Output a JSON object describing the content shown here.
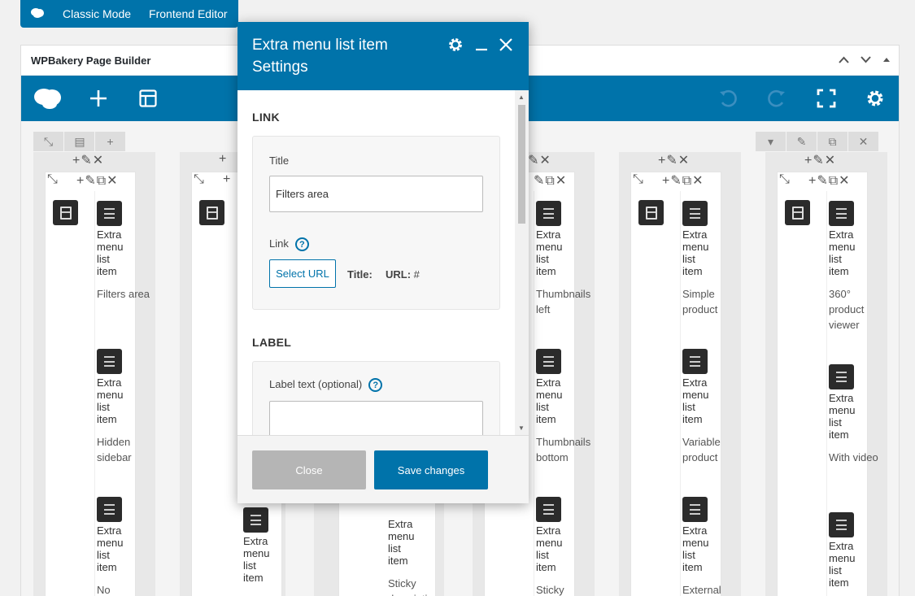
{
  "modes": {
    "classic": "Classic Mode",
    "frontend": "Frontend Editor"
  },
  "panel": {
    "title": "WPBakery Page Builder"
  },
  "modal": {
    "title": "Extra menu list item Settings",
    "link_section": "LINK",
    "title_label": "Title",
    "title_value": "Filters area",
    "link_label": "Link",
    "select_url": "Select URL",
    "title_meta": "Title:",
    "url_meta": "URL: #",
    "label_section": "LABEL",
    "label_text": "Label text (optional)",
    "label_value": "",
    "close": "Close",
    "save": "Save changes"
  },
  "columns": [
    {
      "blocks": [
        {
          "name": "Extra menu list item",
          "value": "Filters area"
        },
        {
          "name": "Extra menu list item",
          "value": "Hidden sidebar"
        },
        {
          "name": "Extra menu list item",
          "value": "No"
        }
      ]
    },
    {
      "blocks": [
        {
          "name": "Extra menu list item",
          "value": ""
        }
      ]
    },
    {
      "blocks": [
        {
          "name": "Extra menu list item",
          "value": "Sticky description"
        }
      ]
    },
    {
      "blocks": [
        {
          "name": "Extra menu list item",
          "value": "Thumbnails left"
        },
        {
          "name": "Extra menu list item",
          "value": "Thumbnails bottom"
        },
        {
          "name": "Extra menu list item",
          "value": "Sticky"
        }
      ]
    },
    {
      "blocks": [
        {
          "name": "Extra menu list item",
          "value": "Simple product"
        },
        {
          "name": "Extra menu list item",
          "value": "Variable product"
        },
        {
          "name": "Extra menu list item",
          "value": "External"
        }
      ]
    },
    {
      "blocks": [
        {
          "name": "Extra menu list item",
          "value": "360° product viewer"
        },
        {
          "name": "Extra menu list item",
          "value": "With video"
        },
        {
          "name": "Extra menu list item",
          "value": ""
        }
      ]
    }
  ],
  "icons": {
    "logo": "wpbakery-cloud-icon",
    "add": "plus-icon",
    "layout": "layout-template-icon",
    "undo": "undo-icon",
    "redo": "redo-icon",
    "fullscreen": "fullscreen-icon",
    "settings": "gear-icon"
  },
  "colors": {
    "brand": "#0073aa",
    "close_button": "#b5b5b5",
    "block_icon": "#2b2b2b"
  }
}
